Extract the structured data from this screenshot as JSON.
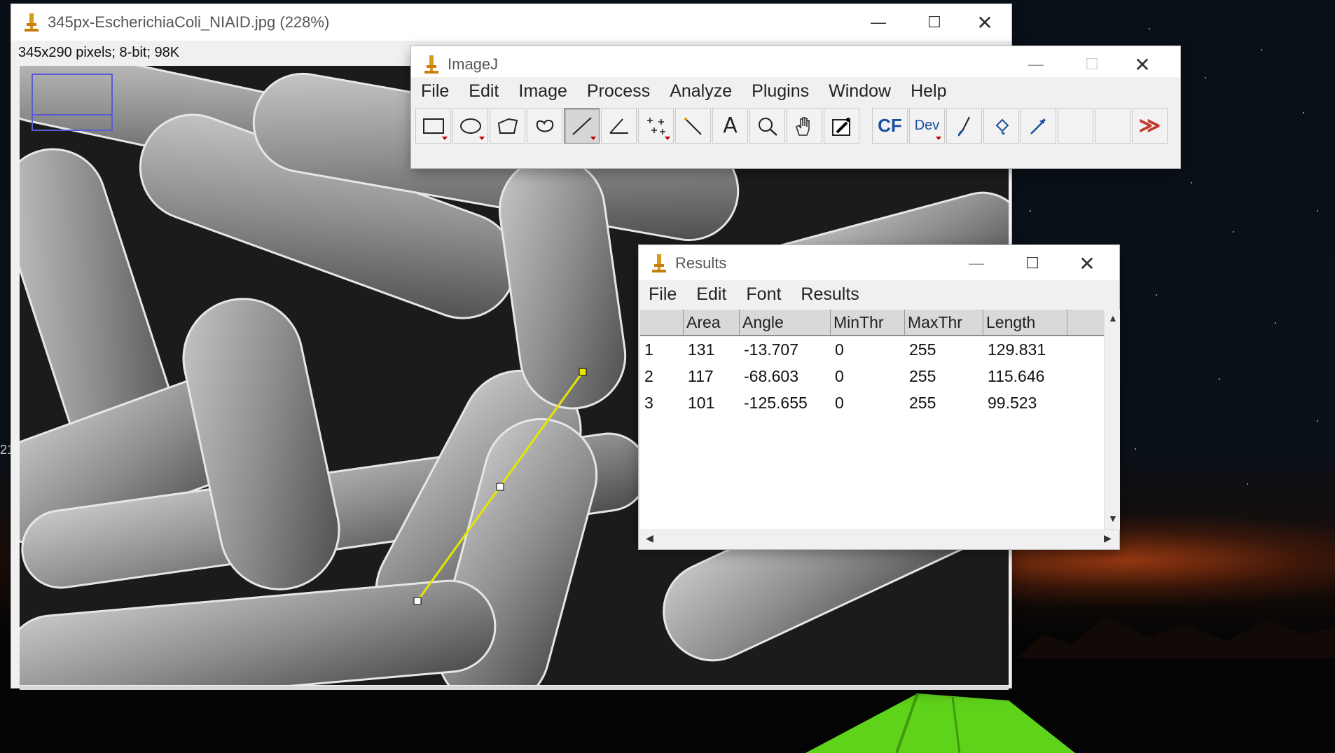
{
  "image_window": {
    "title": "345px-EscherichiaColi_NIAID.jpg (228%)",
    "info": "345x290 pixels; 8-bit; 98K",
    "icon": "microscope-icon"
  },
  "imagej_window": {
    "title": "ImageJ",
    "menus": [
      "File",
      "Edit",
      "Image",
      "Process",
      "Analyze",
      "Plugins",
      "Window",
      "Help"
    ],
    "tools": [
      {
        "name": "rectangle-tool-icon"
      },
      {
        "name": "oval-tool-icon"
      },
      {
        "name": "polygon-tool-icon"
      },
      {
        "name": "freehand-tool-icon"
      },
      {
        "name": "straight-line-tool-icon",
        "selected": true
      },
      {
        "name": "angle-tool-icon"
      },
      {
        "name": "multipoint-tool-icon"
      },
      {
        "name": "wand-tool-icon"
      },
      {
        "name": "text-tool-icon",
        "label": "A"
      },
      {
        "name": "magnifier-tool-icon"
      },
      {
        "name": "hand-tool-icon"
      },
      {
        "name": "color-picker-tool-icon"
      },
      {
        "name": "cf-tool-icon",
        "label": "CF"
      },
      {
        "name": "developer-menu-icon",
        "label": "Dev"
      },
      {
        "name": "brush-tool-icon"
      },
      {
        "name": "flood-filler-tool-icon"
      },
      {
        "name": "arrow-tool-icon"
      },
      {
        "name": "empty-slot-1"
      },
      {
        "name": "empty-slot-2"
      },
      {
        "name": "more-tools-icon",
        "label": "≫"
      }
    ]
  },
  "results_window": {
    "title": "Results",
    "menus": [
      "File",
      "Edit",
      "Font",
      "Results"
    ],
    "columns": [
      "",
      "Area",
      "Angle",
      "MinThr",
      "MaxThr",
      "Length"
    ],
    "rows": [
      [
        "1",
        "131",
        "-13.707",
        "0",
        "255",
        "129.831"
      ],
      [
        "2",
        "117",
        "-68.603",
        "0",
        "255",
        "115.646"
      ],
      [
        "3",
        "101",
        "-125.655",
        "0",
        "255",
        "99.523"
      ]
    ]
  },
  "desktop": {
    "edge_text": "21"
  },
  "colors": {
    "selection_line": "#e6e600",
    "overview_box": "#5b5bd6",
    "more_tools": "#c0392b",
    "cf_blue": "#1a4fa3"
  }
}
